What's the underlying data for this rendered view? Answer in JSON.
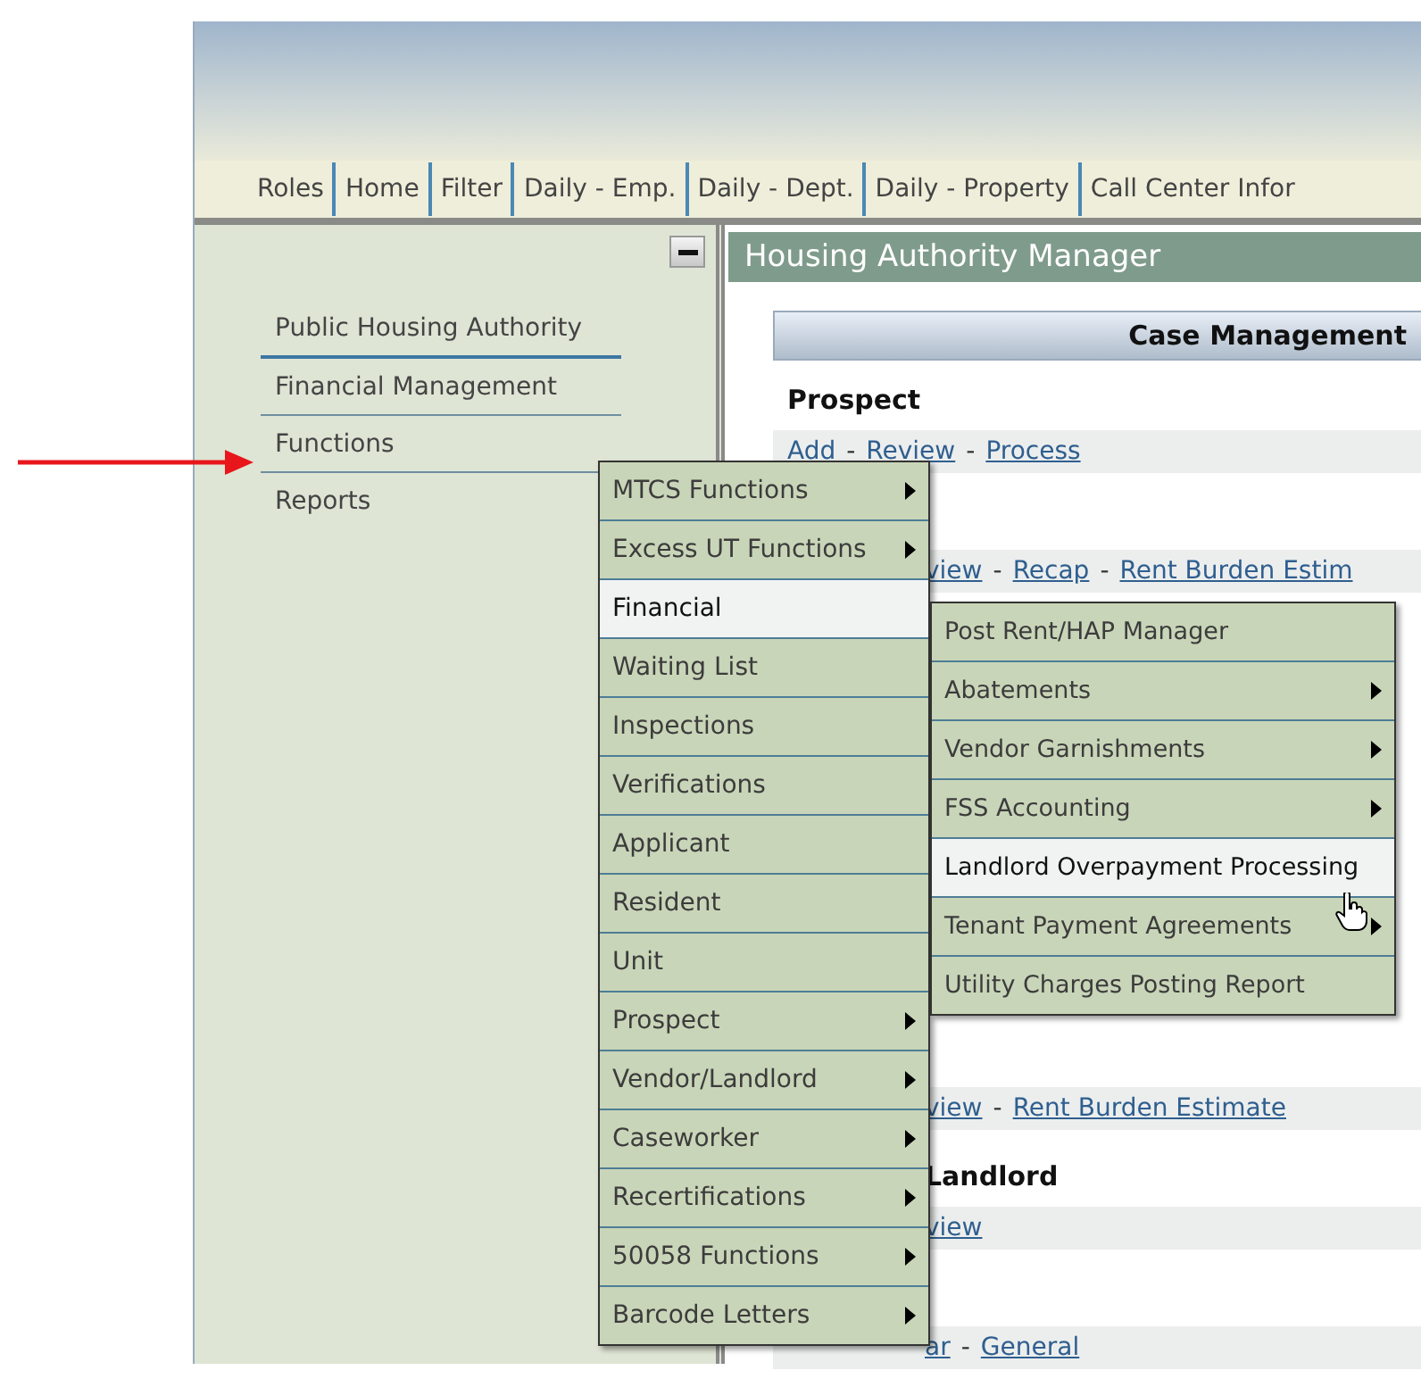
{
  "nav": [
    "Roles",
    "Home",
    "Filter",
    "Daily - Emp.",
    "Daily - Dept.",
    "Daily - Property",
    "Call Center Infor"
  ],
  "sidebar": {
    "items": [
      "Public Housing Authority",
      "Financial Management",
      "Functions",
      "Reports"
    ]
  },
  "panel_title": "Housing Authority Manager",
  "section_header": "Case Management",
  "rows": [
    {
      "kind": "heading",
      "covered_left": false,
      "parts": [
        {
          "kind": "text",
          "text": "Prospect"
        }
      ]
    },
    {
      "kind": "links",
      "covered_left": false,
      "parts": [
        {
          "kind": "link",
          "text": "Add"
        },
        {
          "kind": "sep",
          "text": "-"
        },
        {
          "kind": "link",
          "text": "Review"
        },
        {
          "kind": "sep",
          "text": "-"
        },
        {
          "kind": "link",
          "text": "Process"
        }
      ]
    },
    {
      "kind": "links",
      "covered_left": true,
      "parts": [
        {
          "kind": "link",
          "text": "view"
        },
        {
          "kind": "sep",
          "text": "-"
        },
        {
          "kind": "link",
          "text": "Recap"
        },
        {
          "kind": "sep",
          "text": "-"
        },
        {
          "kind": "link",
          "text": "Rent Burden Estim"
        }
      ]
    },
    {
      "kind": "links",
      "covered_left": true,
      "parts": [
        {
          "kind": "link",
          "text": "view"
        },
        {
          "kind": "sep",
          "text": "-"
        },
        {
          "kind": "link",
          "text": "Rent Burden Estimate"
        }
      ]
    },
    {
      "kind": "heading",
      "covered_left": true,
      "parts": [
        {
          "kind": "text",
          "text": "Landlord"
        }
      ]
    },
    {
      "kind": "links",
      "covered_left": true,
      "parts": [
        {
          "kind": "link",
          "text": "view"
        }
      ]
    },
    {
      "kind": "links",
      "covered_left": true,
      "parts": [
        {
          "kind": "link",
          "text": "ar"
        },
        {
          "kind": "sep",
          "text": "-"
        },
        {
          "kind": "link",
          "text": "General"
        }
      ]
    }
  ],
  "menu": [
    {
      "label": "MTCS Functions",
      "submenu": true,
      "selected": false
    },
    {
      "label": "Excess UT Functions",
      "submenu": true,
      "selected": false
    },
    {
      "label": "Financial",
      "submenu": false,
      "selected": true
    },
    {
      "label": "Waiting List",
      "submenu": false,
      "selected": false
    },
    {
      "label": "Inspections",
      "submenu": false,
      "selected": false
    },
    {
      "label": "Verifications",
      "submenu": false,
      "selected": false
    },
    {
      "label": "Applicant",
      "submenu": false,
      "selected": false
    },
    {
      "label": "Resident",
      "submenu": false,
      "selected": false
    },
    {
      "label": "Unit",
      "submenu": false,
      "selected": false
    },
    {
      "label": "Prospect",
      "submenu": true,
      "selected": false
    },
    {
      "label": "Vendor/Landlord",
      "submenu": true,
      "selected": false
    },
    {
      "label": "Caseworker",
      "submenu": true,
      "selected": false
    },
    {
      "label": "Recertifications",
      "submenu": true,
      "selected": false
    },
    {
      "label": "50058 Functions",
      "submenu": true,
      "selected": false
    },
    {
      "label": "Barcode Letters",
      "submenu": true,
      "selected": false
    }
  ],
  "submenu": [
    {
      "label": "Post Rent/HAP Manager",
      "submenu": false,
      "selected": false
    },
    {
      "label": "Abatements",
      "submenu": true,
      "selected": false
    },
    {
      "label": "Vendor Garnishments",
      "submenu": true,
      "selected": false
    },
    {
      "label": "FSS Accounting",
      "submenu": true,
      "selected": false
    },
    {
      "label": "Landlord Overpayment Processing",
      "submenu": false,
      "selected": true
    },
    {
      "label": "Tenant Payment Agreements",
      "submenu": true,
      "selected": false
    },
    {
      "label": "Utility Charges Posting Report",
      "submenu": false,
      "selected": false
    }
  ]
}
